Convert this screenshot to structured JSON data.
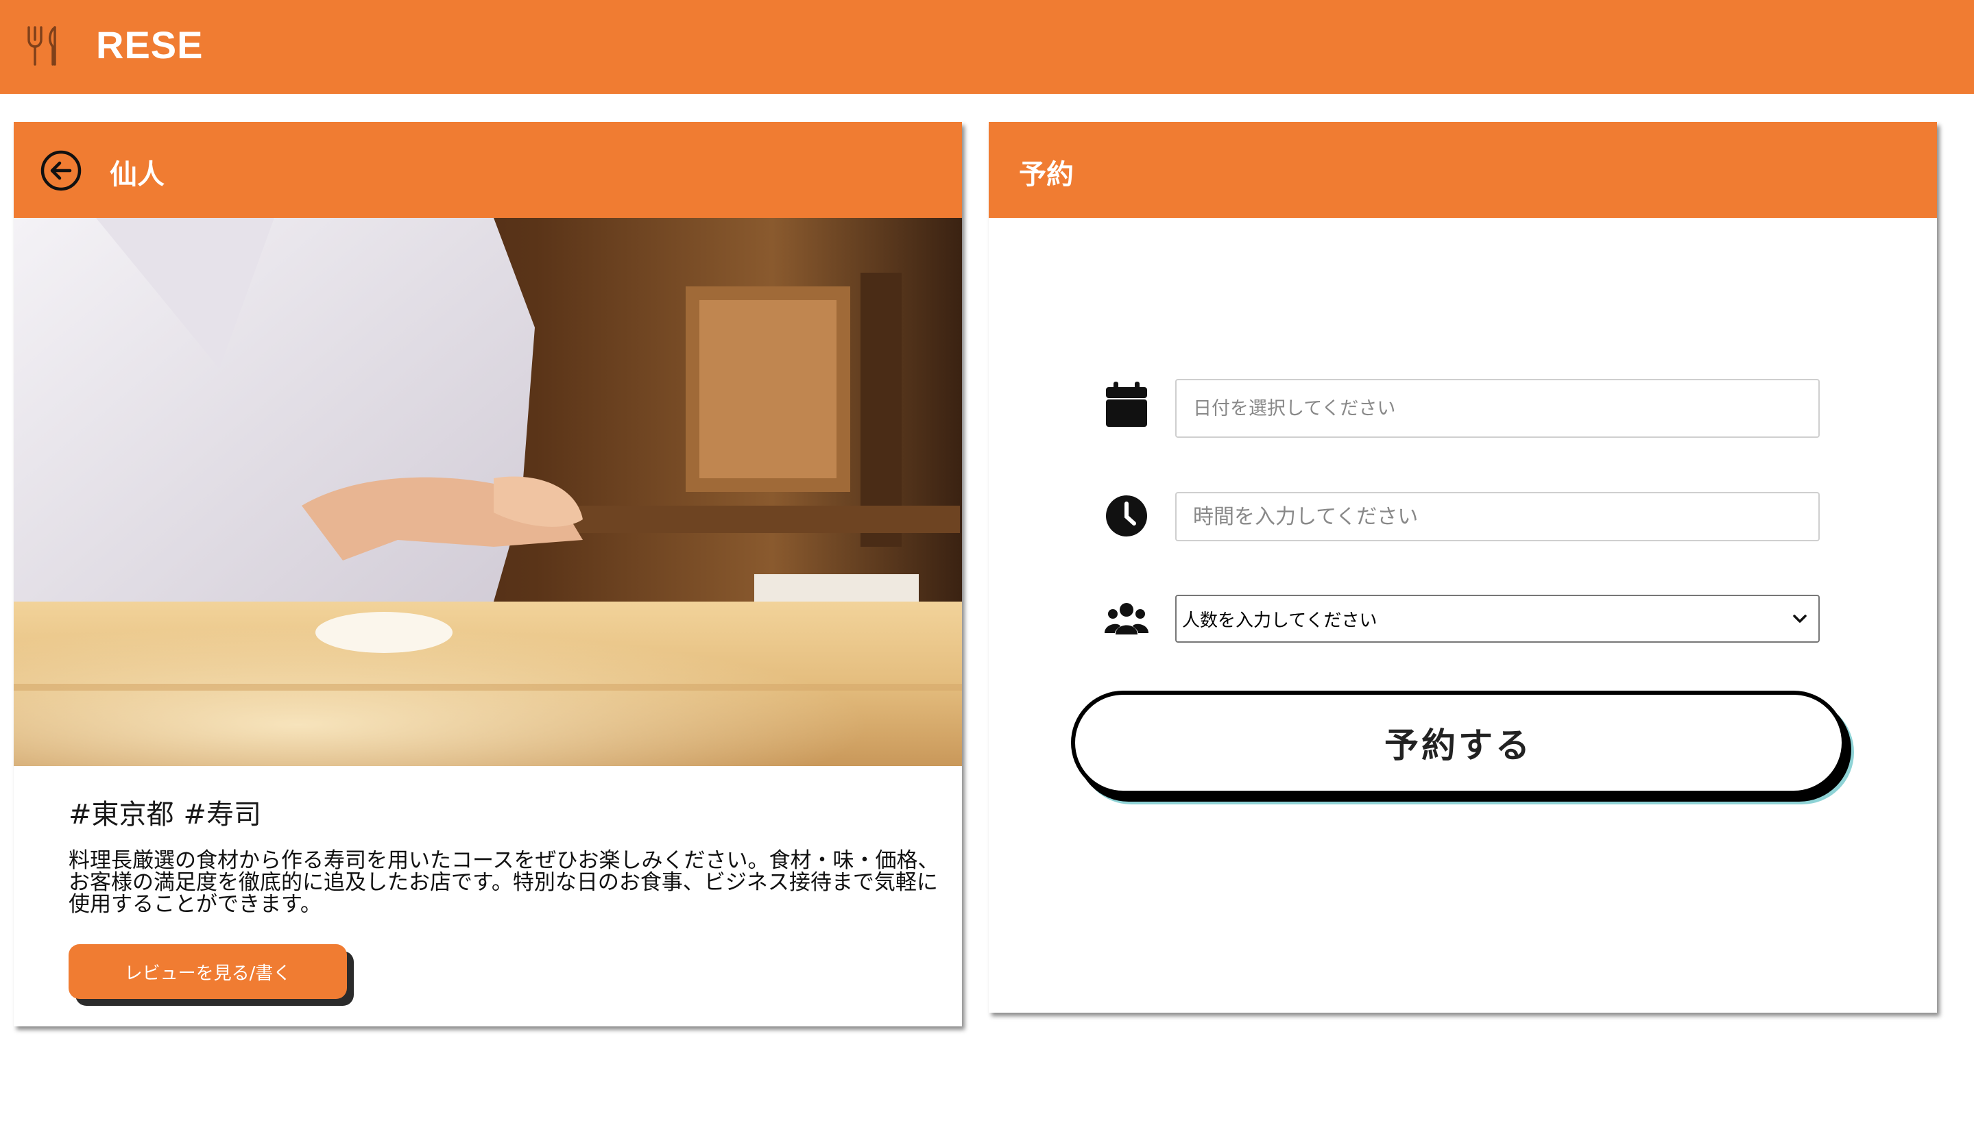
{
  "app": {
    "title": "RESE",
    "brand_color": "#f07c32",
    "logo_icon": "fork-knife-icon"
  },
  "shop": {
    "name": "仙人",
    "back_icon": "arrow-left-circle-icon",
    "image": "sushi-chef-photo",
    "tags": [
      "#東京都",
      "#寿司"
    ],
    "description": "料理長厳選の食材から作る寿司を用いたコースをぜひお楽しみください。食材・味・価格、お客様の満足度を徹底的に追及したお店です。特別な日のお食事、ビジネス接待まで気軽に使用することができます。",
    "review_button": "レビューを見る/書く"
  },
  "reservation": {
    "title": "予約",
    "date": {
      "icon": "calendar-icon",
      "placeholder": "日付を選択してください",
      "value": ""
    },
    "time": {
      "icon": "clock-icon",
      "placeholder": "時間を入力してください",
      "value": ""
    },
    "people": {
      "icon": "users-icon",
      "selected": "人数を入力してください"
    },
    "submit_label": "予約する",
    "submit_shadow_color": "#8fd3d6"
  }
}
